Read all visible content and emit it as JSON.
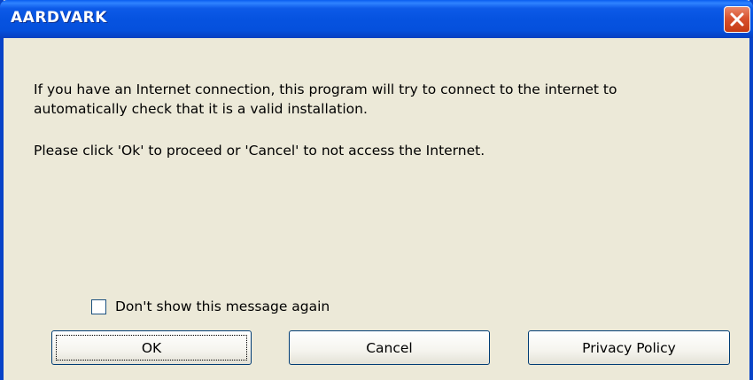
{
  "window": {
    "title": "AARDVARK"
  },
  "message": {
    "line1": "If you have an Internet connection, this program will try to connect to the internet to",
    "line2": "automatically check that it is a valid installation.",
    "line3": "Please click 'Ok' to proceed or 'Cancel' to not access the Internet."
  },
  "options": {
    "dont_show_label": "Don't show this message again",
    "dont_show_checked": false
  },
  "buttons": {
    "ok_label": "OK",
    "cancel_label": "Cancel",
    "privacy_label": "Privacy Policy"
  },
  "icons": {
    "close": "close-icon"
  },
  "colors": {
    "titlebar": "#0653e0",
    "dialog_background": "#ece9d8",
    "close_button": "#d8522e"
  }
}
